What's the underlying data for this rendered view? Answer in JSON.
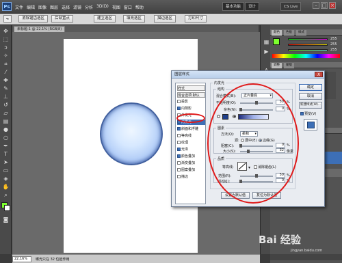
{
  "app": {
    "logo": "Ps",
    "menus": [
      "文件",
      "编辑",
      "图像",
      "图层",
      "选择",
      "滤镜",
      "分析",
      "3D(D)",
      "视图",
      "窗口",
      "帮助"
    ],
    "workspace_button": "基本功能",
    "design_button": "设计",
    "search": "CS Live"
  },
  "options_bar": {
    "refine_edge": "消除锯齿选区",
    "create_plane": "后部置点",
    "buttons": [
      "建立选区",
      "填充选区",
      "描边选区",
      "打印尺寸"
    ]
  },
  "document": {
    "tab": "未标题-1 @ 22.1% (RGB/8)",
    "zoom": "22.16%",
    "status": "曝光只在 32 位起作用"
  },
  "dialog": {
    "title": "图层样式",
    "close": "X",
    "style_list": [
      {
        "label": "样式",
        "checked": false,
        "kind": "header"
      },
      {
        "label": "混合选项:默认",
        "checked": false,
        "kind": "header"
      },
      {
        "label": "投影",
        "checked": false
      },
      {
        "label": "内阴影",
        "checked": true
      },
      {
        "label": "外发光",
        "checked": false
      },
      {
        "label": "内发光",
        "checked": true,
        "selected": true
      },
      {
        "label": "斜面和浮雕",
        "checked": true
      },
      {
        "label": "等高线",
        "checked": false
      },
      {
        "label": "纹理",
        "checked": false
      },
      {
        "label": "光泽",
        "checked": true
      },
      {
        "label": "颜色叠加",
        "checked": true
      },
      {
        "label": "渐变叠加",
        "checked": false
      },
      {
        "label": "图案叠加",
        "checked": false
      },
      {
        "label": "描边",
        "checked": false
      }
    ],
    "section_title": "内发光",
    "structure": {
      "title": "结构",
      "blend_mode_label": "混合模式(B):",
      "blend_mode_value": "正片叠底",
      "opacity_label": "不透明度(O):",
      "opacity_value": "50",
      "noise_label": "杂色(N):",
      "noise_value": "0",
      "unit": "%"
    },
    "elements": {
      "title": "图素",
      "method_label": "方法(Q):",
      "method_value": "柔和",
      "source_label": "源:",
      "source_center": "居中(E)",
      "source_edge": "边缘(G)",
      "choke_label": "阻塞(C):",
      "choke_value": "0",
      "size_label": "大小(S):",
      "size_value": "32",
      "size_unit": "像素"
    },
    "quality": {
      "title": "品质",
      "contour_label": "等高线:",
      "antialias_label": "消除锯齿(L)",
      "range_label": "范围(R):",
      "range_value": "50",
      "jitter_label": "抖动(J):",
      "jitter_value": "0",
      "unit": "%"
    },
    "bottom_buttons": [
      "设置为默认值",
      "复位为默认值"
    ],
    "side_buttons": {
      "ok": "确定",
      "cancel": "取消",
      "new_style": "新建样式(W)...",
      "preview": "预览(V)"
    }
  },
  "panels": {
    "color_tabs": [
      "颜色",
      "色板",
      "样式"
    ],
    "rgb_values": [
      "255",
      "255",
      "255"
    ],
    "adjust_tabs": [
      "调整",
      "蒙版"
    ],
    "layers_tabs": [
      "图层",
      "通道",
      "路径"
    ]
  },
  "watermark": {
    "text": "Bai 经验",
    "url": "jingyan.baidu.com"
  },
  "colors": {
    "accent": "#3d6fb6",
    "highlight_ring": "#e01a1a",
    "ball_edge": "#42619f",
    "foreground_swatch": "#7dff2e"
  }
}
